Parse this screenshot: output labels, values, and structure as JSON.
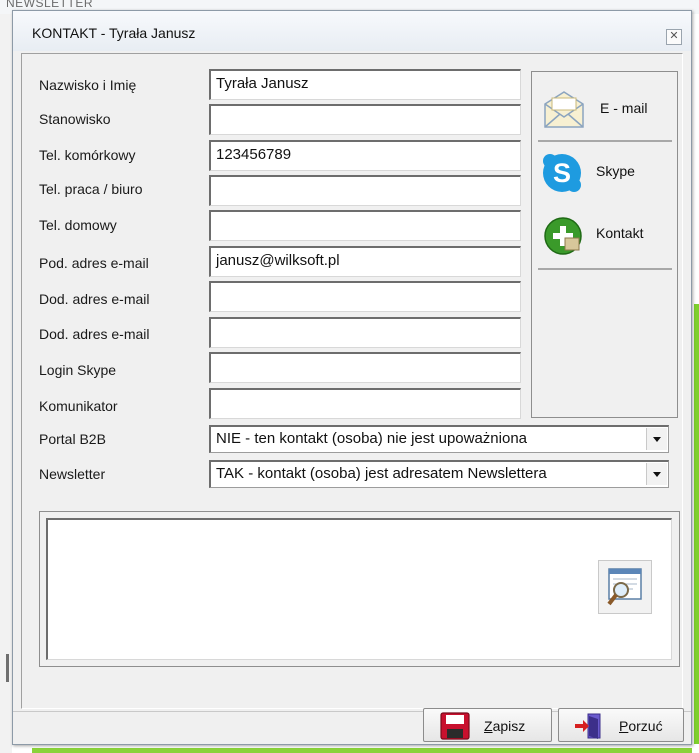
{
  "background": {
    "title": "NEWSLETTER"
  },
  "window": {
    "title": "KONTAKT - Tyrała Janusz",
    "close_glyph": "✕"
  },
  "form": {
    "fields": [
      {
        "label": "Nazwisko i Imię",
        "value": "Tyrała Janusz"
      },
      {
        "label": "Stanowisko",
        "value": ""
      },
      {
        "label": "Tel. komórkowy",
        "value": "123456789"
      },
      {
        "label": "Tel. praca / biuro",
        "value": ""
      },
      {
        "label": "Tel. domowy",
        "value": ""
      },
      {
        "label": "Pod. adres e-mail",
        "value": "janusz@wilksoft.pl"
      },
      {
        "label": "Dod. adres e-mail",
        "value": ""
      },
      {
        "label": "Dod. adres e-mail",
        "value": ""
      },
      {
        "label": "Login Skype",
        "value": ""
      },
      {
        "label": "Komunikator",
        "value": ""
      }
    ],
    "portal_b2b": {
      "label": "Portal B2B",
      "value": "NIE - ten kontakt (osoba) nie jest upoważniona"
    },
    "newsletter": {
      "label": "Newsletter",
      "value": "TAK - kontakt (osoba) jest adresatem Newslettera"
    }
  },
  "side_buttons": {
    "email": {
      "label": "E - mail",
      "icon": "envelope-icon"
    },
    "skype": {
      "label": "Skype",
      "icon": "skype-icon"
    },
    "contact": {
      "label": "Kontakt",
      "icon": "add-contact-icon"
    }
  },
  "notes": {
    "value": "",
    "search_icon": "magnifier-icon"
  },
  "actions": {
    "save": {
      "mnemonic": "Z",
      "rest": "apisz",
      "icon": "floppy-disk-icon"
    },
    "cancel": {
      "mnemonic": "P",
      "rest": "orzuć",
      "icon": "exit-door-icon"
    }
  },
  "colors": {
    "skype_blue": "#1e9be0",
    "contact_green": "#3a9a2a",
    "save_red": "#c8102e",
    "accent_green": "#7ed02c"
  }
}
